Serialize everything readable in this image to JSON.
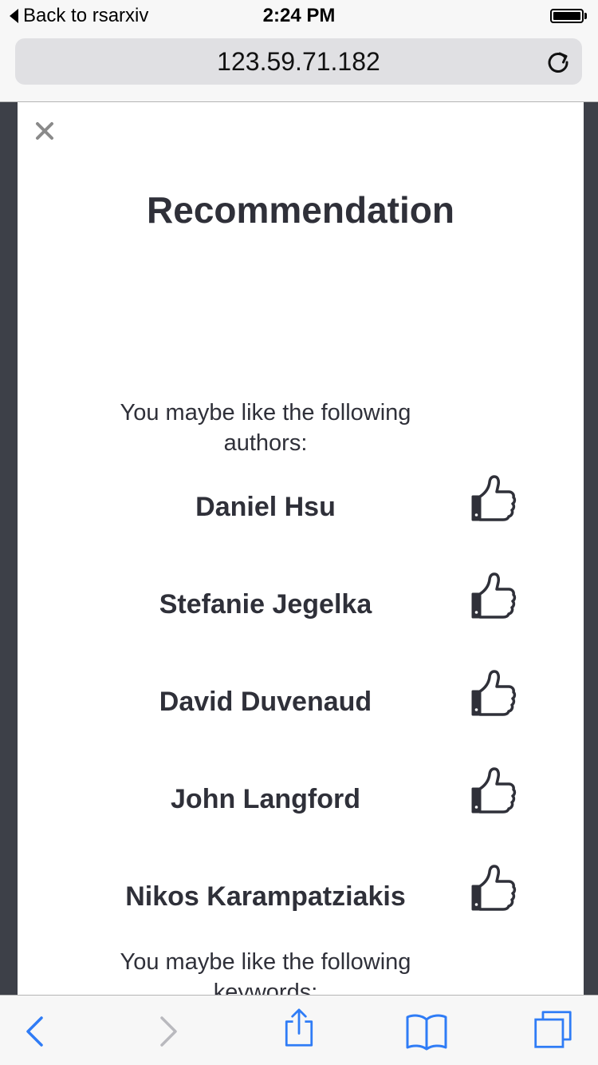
{
  "status_bar": {
    "back_app_label": "Back to rsarxiv",
    "time": "2:24 PM",
    "battery_icon": "battery-icon"
  },
  "address_bar": {
    "url": "123.59.71.182",
    "reload_icon": "reload-icon"
  },
  "modal": {
    "close_icon": "close-icon",
    "title": "Recommendation",
    "authors_intro": "You maybe like the following authors:",
    "authors": [
      {
        "name": "Daniel Hsu",
        "icon": "thumbs-up-icon"
      },
      {
        "name": "Stefanie Jegelka",
        "icon": "thumbs-up-icon"
      },
      {
        "name": "David Duvenaud",
        "icon": "thumbs-up-icon"
      },
      {
        "name": "John Langford",
        "icon": "thumbs-up-icon"
      },
      {
        "name": "Nikos Karampatziakis",
        "icon": "thumbs-up-icon"
      }
    ],
    "keywords_intro": "You maybe like the following keywords:"
  },
  "toolbar": {
    "icons": [
      "back-arrow-icon",
      "forward-arrow-icon",
      "share-icon",
      "bookmarks-icon",
      "tabs-icon"
    ]
  },
  "colors": {
    "backdrop": "#3d4048",
    "text": "#2f3039",
    "ios_blue": "#2f7cf6",
    "disabled": "#b9b9be"
  }
}
